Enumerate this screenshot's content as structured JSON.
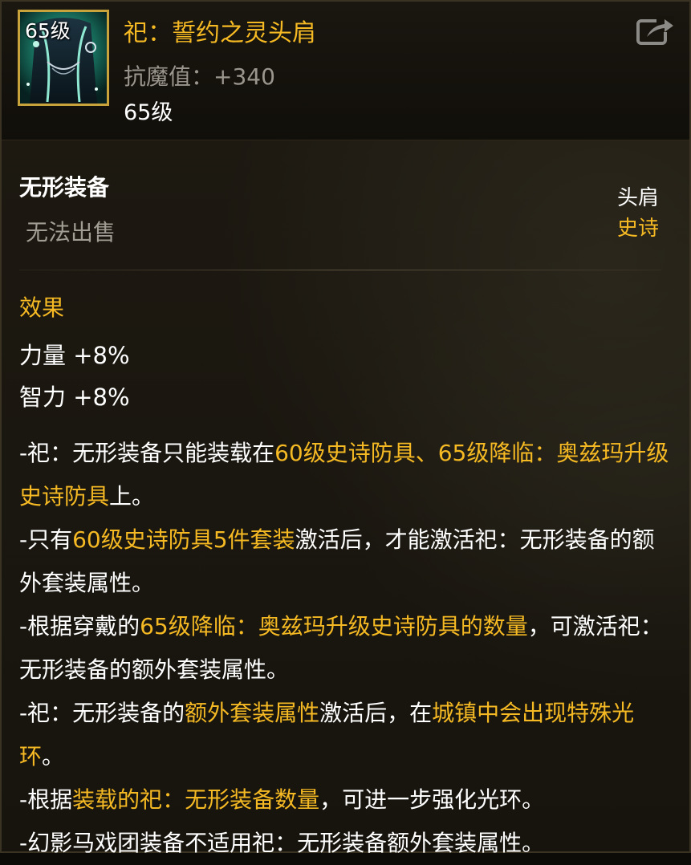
{
  "item": {
    "icon_level": "65级",
    "name": "祀：誓约之灵头肩",
    "stat": "抗魔值：+340",
    "level": "65级",
    "icon_name": "shoulder-armor-icon"
  },
  "header": {
    "share_icon": "share-icon"
  },
  "info": {
    "type": "无形装备",
    "unsellable": "无法出售",
    "slot": "头肩",
    "rarity": "史诗"
  },
  "effects": {
    "title": "效果",
    "lines": [
      "力量 +8%",
      "智力 +8%"
    ]
  },
  "description": [
    [
      {
        "t": "-祀：无形装备只能装载在",
        "hl": false
      },
      {
        "t": "60级史诗防具、65级降临：奥兹玛升级史诗防具",
        "hl": true
      },
      {
        "t": "上。",
        "hl": false
      }
    ],
    [
      {
        "t": "-只有",
        "hl": false
      },
      {
        "t": "60级史诗防具5件套装",
        "hl": true
      },
      {
        "t": "激活后，才能激活祀：无形装备的额外套装属性。",
        "hl": false
      }
    ],
    [
      {
        "t": "-根据穿戴的",
        "hl": false
      },
      {
        "t": "65级降临：奥兹玛升级史诗防具的数量",
        "hl": true
      },
      {
        "t": "，可激活祀：无形装备的额外套装属性。",
        "hl": false
      }
    ],
    [
      {
        "t": "-祀：无形装备的",
        "hl": false
      },
      {
        "t": "额外套装属性",
        "hl": true
      },
      {
        "t": "激活后，在",
        "hl": false
      },
      {
        "t": "城镇中会出现特殊光环",
        "hl": true
      },
      {
        "t": "。",
        "hl": false
      }
    ],
    [
      {
        "t": "-根据",
        "hl": false
      },
      {
        "t": "装载的祀：无形装备数量",
        "hl": true
      },
      {
        "t": "，可进一步强化光环。",
        "hl": false
      }
    ],
    [
      {
        "t": "-幻影马戏团装备不适用祀：无形装备额外套装属性。",
        "hl": false
      }
    ]
  ],
  "colors": {
    "gold": "#f5b923",
    "white": "#ffffff",
    "grey": "#a19d94",
    "frame": "#c8a23a"
  }
}
